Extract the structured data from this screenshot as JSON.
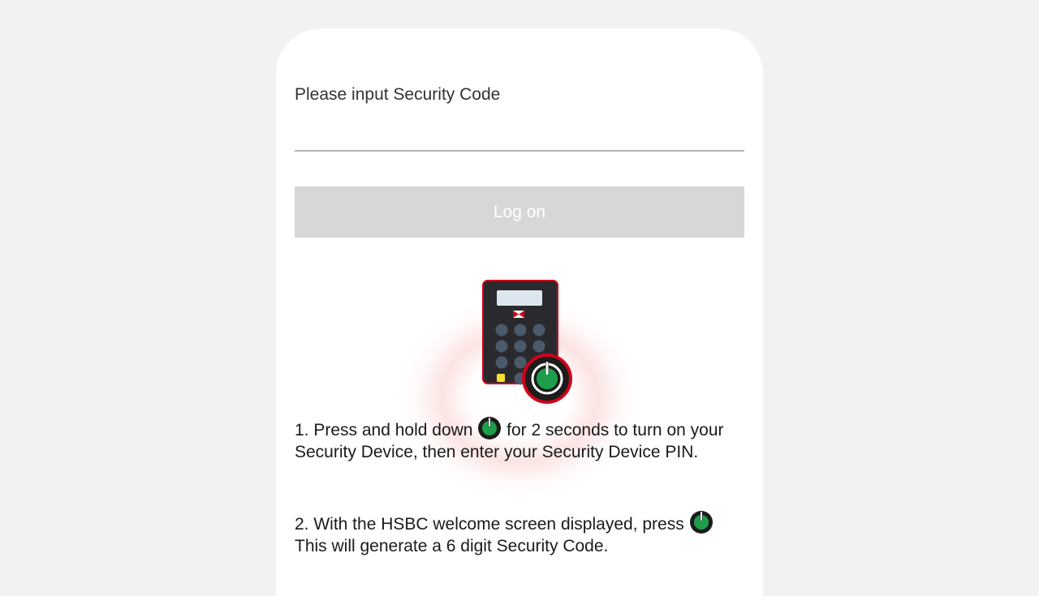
{
  "form": {
    "security_code_label": "Please input Security Code",
    "security_code_value": "",
    "logon_label": "Log on"
  },
  "instructions": {
    "step1_before": "1. Press and hold down",
    "step1_after": "for 2 seconds to turn on your Security Device, then enter your Security Device PIN.",
    "step2_before": "2. With the HSBC welcome screen displayed, press",
    "step2_after": "This will generate a 6 digit Security Code."
  },
  "icons": {
    "device": "security-device-icon",
    "power": "power-button-icon"
  },
  "colors": {
    "background": "#f2f2f2",
    "card": "#ffffff",
    "button_disabled": "#d7d7d5",
    "power_green": "#1e9e4a",
    "hsbc_red": "#db0011"
  }
}
